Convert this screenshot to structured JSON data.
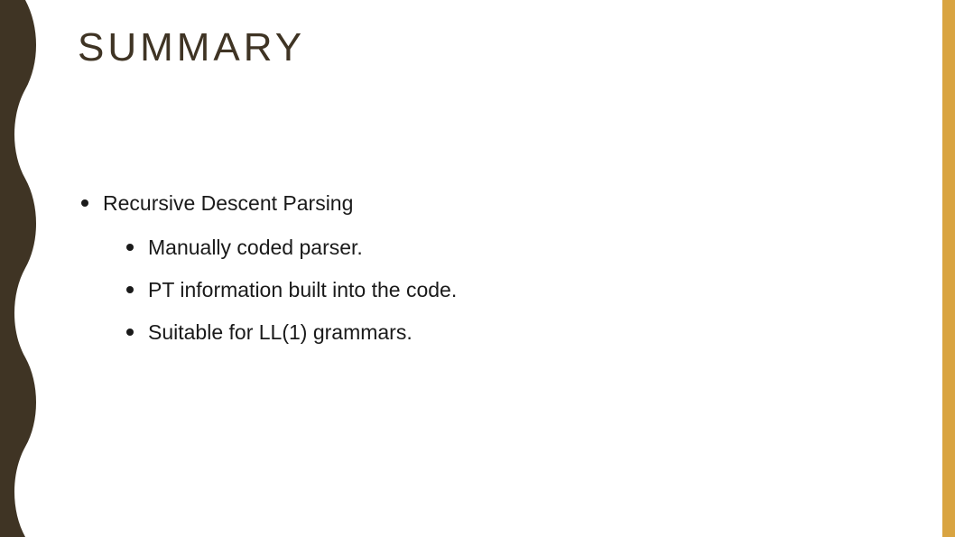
{
  "title": "SUMMARY",
  "bullets": {
    "level1": [
      {
        "text": "Recursive Descent Parsing",
        "children": [
          "Manually coded parser.",
          "PT information built into the code.",
          "Suitable for LL(1) grammars."
        ]
      }
    ]
  },
  "theme": {
    "wave_color": "#3f3424",
    "accent_color": "#d9a441"
  }
}
